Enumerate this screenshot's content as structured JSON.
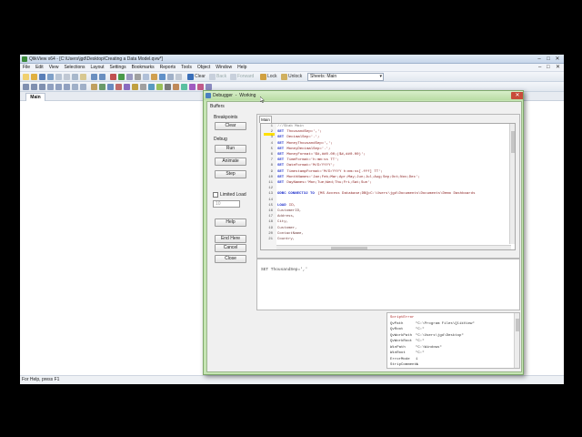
{
  "window": {
    "title": "QlikView x64 - [C:\\Users\\jgd\\Desktop\\Creating a Data Model.qvw*]",
    "controls": [
      "–",
      "□",
      "✕"
    ]
  },
  "menu": {
    "items": [
      "File",
      "Edit",
      "View",
      "Selections",
      "Layout",
      "Settings",
      "Bookmarks",
      "Reports",
      "Tools",
      "Object",
      "Window",
      "Help"
    ],
    "right_controls": [
      "–",
      "□",
      "✕"
    ]
  },
  "toolbar": {
    "clear_label": "Clear",
    "back_label": "Back",
    "forward_label": "Forward",
    "lock_label": "Lock",
    "unlock_label": "Unlock",
    "sheet_select_value": "Sheets: Main",
    "sheet_select_arrow": "▾"
  },
  "sheets": {
    "active_tab": "Main"
  },
  "status": {
    "text": "For Help, press F1"
  },
  "debugger": {
    "title_prefix": "Debugger",
    "title_state": "Working",
    "close_glyph": "✕",
    "buffers_label": "Buffers",
    "breakpoints_label": "Breakpoints",
    "clear_button": "Clear",
    "debug_label": "Debug",
    "run_button": "Run",
    "animate_button": "Animate",
    "step_button": "Step",
    "limited_load_label": "Limited Load",
    "limited_load_value": "10",
    "help_button": "Help",
    "end_here_button": "End Here",
    "cancel_button": "Cancel",
    "close_button": "Close",
    "editor_tab": "Main",
    "code": [
      {
        "n": "1",
        "kw": "",
        "text": "///$tab Main"
      },
      {
        "n": "2",
        "kw": "SET",
        "text": "ThousandSep=',';"
      },
      {
        "n": "3",
        "kw": "SET",
        "text": "DecimalSep='.';"
      },
      {
        "n": "4",
        "kw": "SET",
        "text": "MoneyThousandSep=',';"
      },
      {
        "n": "5",
        "kw": "SET",
        "text": "MoneyDecimalSep='.';"
      },
      {
        "n": "6",
        "kw": "SET",
        "text": "MoneyFormat='$#,##0.00;($#,##0.00)';"
      },
      {
        "n": "7",
        "kw": "SET",
        "text": "TimeFormat='h:mm:ss TT';"
      },
      {
        "n": "8",
        "kw": "SET",
        "text": "DateFormat='M/D/YYYY';"
      },
      {
        "n": "9",
        "kw": "SET",
        "text": "TimestampFormat='M/D/YYYY h:mm:ss[.fff] TT';"
      },
      {
        "n": "10",
        "kw": "SET",
        "text": "MonthNames='Jan;Feb;Mar;Apr;May;Jun;Jul;Aug;Sep;Oct;Nov;Dec';"
      },
      {
        "n": "11",
        "kw": "SET",
        "text": "DayNames='Mon;Tue;Wed;Thu;Fri;Sat;Sun';"
      },
      {
        "n": "12",
        "kw": "",
        "text": ""
      },
      {
        "n": "13",
        "kw": "ODBC CONNECT32 TO",
        "text": "[MS Access Database;DBQ=C:\\Users\\jgd\\Documents\\Documents\\Demo Dashboards"
      },
      {
        "n": "14",
        "kw": "",
        "text": ""
      },
      {
        "n": "15",
        "kw": "LOAD",
        "text": "ID,"
      },
      {
        "n": "16",
        "kw": "",
        "text": "    CustomerID,"
      },
      {
        "n": "17",
        "kw": "",
        "text": "    Address,"
      },
      {
        "n": "18",
        "kw": "",
        "text": "    City,"
      },
      {
        "n": "19",
        "kw": "",
        "text": "    Customer,"
      },
      {
        "n": "20",
        "kw": "",
        "text": "    ContactName,"
      },
      {
        "n": "21",
        "kw": "",
        "text": "    Country,"
      }
    ],
    "trace_line": "SET ThousandSep=','",
    "variables": [
      {
        "name": "ScriptError",
        "value": "",
        "header": true
      },
      {
        "name": "QvPath",
        "value": "\"C:\\Program Files\\QlikView\""
      },
      {
        "name": "QvRoot",
        "value": "\"C:\""
      },
      {
        "name": "QvWorkPath",
        "value": "\"C:\\Users\\jgd\\Desktop\""
      },
      {
        "name": "QvWorkRoot",
        "value": "\"C:\""
      },
      {
        "name": "WinPath",
        "value": "\"C:\\Windows\""
      },
      {
        "name": "WinRoot",
        "value": "\"C:\""
      },
      {
        "name": "ErrorMode",
        "value": "1"
      },
      {
        "name": "StripComments",
        "value": "1"
      }
    ]
  }
}
